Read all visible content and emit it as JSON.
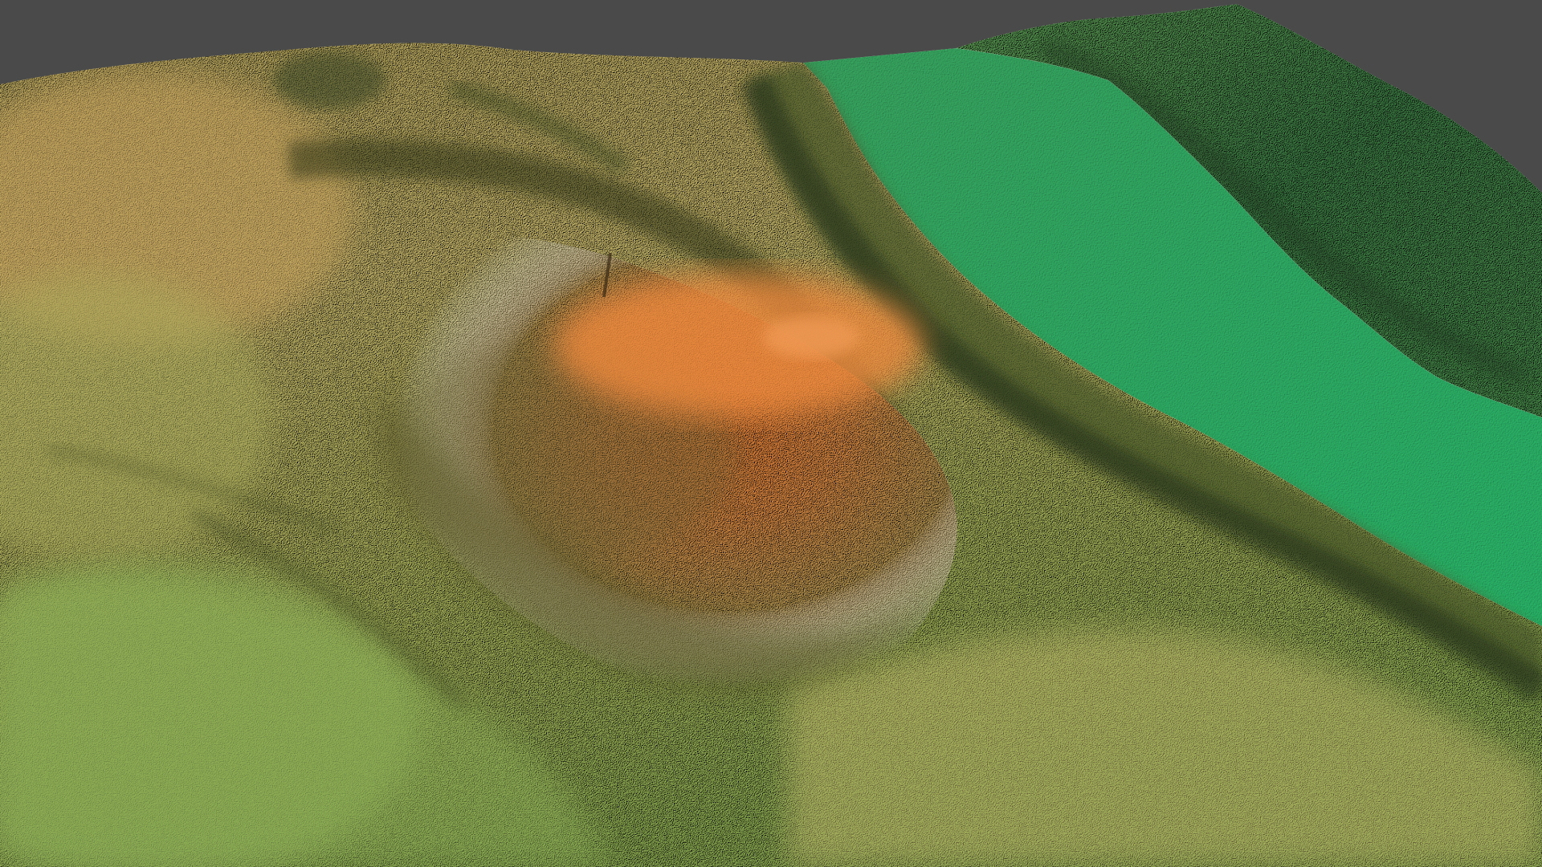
{
  "scene": {
    "background_color": "#4a4a4a",
    "view": "3d-perspective",
    "render_style": "shaded-relief"
  },
  "elevation_color_ramp": {
    "low_water": "#2fb36a",
    "low_slope": "#3f8f50",
    "mid_low": "#8fae55",
    "mid": "#c2b868",
    "mid_high": "#c8934c",
    "high": "#e0803a",
    "shadow": "#2c3a1c"
  },
  "features": [
    "river-channel",
    "central-hill",
    "hilltop-summit",
    "far-ridge",
    "river-bank-slope",
    "left-upland",
    "foreground-slope"
  ]
}
